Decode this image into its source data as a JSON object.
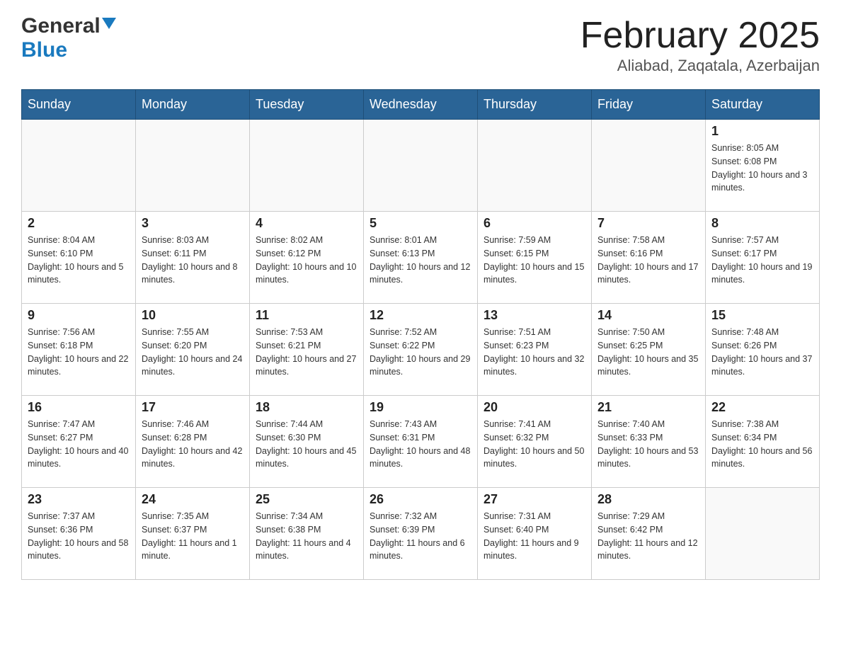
{
  "header": {
    "logo_general": "General",
    "logo_blue": "Blue",
    "month_title": "February 2025",
    "location": "Aliabad, Zaqatala, Azerbaijan"
  },
  "weekdays": [
    "Sunday",
    "Monday",
    "Tuesday",
    "Wednesday",
    "Thursday",
    "Friday",
    "Saturday"
  ],
  "weeks": [
    [
      {
        "day": "",
        "info": ""
      },
      {
        "day": "",
        "info": ""
      },
      {
        "day": "",
        "info": ""
      },
      {
        "day": "",
        "info": ""
      },
      {
        "day": "",
        "info": ""
      },
      {
        "day": "",
        "info": ""
      },
      {
        "day": "1",
        "info": "Sunrise: 8:05 AM\nSunset: 6:08 PM\nDaylight: 10 hours and 3 minutes."
      }
    ],
    [
      {
        "day": "2",
        "info": "Sunrise: 8:04 AM\nSunset: 6:10 PM\nDaylight: 10 hours and 5 minutes."
      },
      {
        "day": "3",
        "info": "Sunrise: 8:03 AM\nSunset: 6:11 PM\nDaylight: 10 hours and 8 minutes."
      },
      {
        "day": "4",
        "info": "Sunrise: 8:02 AM\nSunset: 6:12 PM\nDaylight: 10 hours and 10 minutes."
      },
      {
        "day": "5",
        "info": "Sunrise: 8:01 AM\nSunset: 6:13 PM\nDaylight: 10 hours and 12 minutes."
      },
      {
        "day": "6",
        "info": "Sunrise: 7:59 AM\nSunset: 6:15 PM\nDaylight: 10 hours and 15 minutes."
      },
      {
        "day": "7",
        "info": "Sunrise: 7:58 AM\nSunset: 6:16 PM\nDaylight: 10 hours and 17 minutes."
      },
      {
        "day": "8",
        "info": "Sunrise: 7:57 AM\nSunset: 6:17 PM\nDaylight: 10 hours and 19 minutes."
      }
    ],
    [
      {
        "day": "9",
        "info": "Sunrise: 7:56 AM\nSunset: 6:18 PM\nDaylight: 10 hours and 22 minutes."
      },
      {
        "day": "10",
        "info": "Sunrise: 7:55 AM\nSunset: 6:20 PM\nDaylight: 10 hours and 24 minutes."
      },
      {
        "day": "11",
        "info": "Sunrise: 7:53 AM\nSunset: 6:21 PM\nDaylight: 10 hours and 27 minutes."
      },
      {
        "day": "12",
        "info": "Sunrise: 7:52 AM\nSunset: 6:22 PM\nDaylight: 10 hours and 29 minutes."
      },
      {
        "day": "13",
        "info": "Sunrise: 7:51 AM\nSunset: 6:23 PM\nDaylight: 10 hours and 32 minutes."
      },
      {
        "day": "14",
        "info": "Sunrise: 7:50 AM\nSunset: 6:25 PM\nDaylight: 10 hours and 35 minutes."
      },
      {
        "day": "15",
        "info": "Sunrise: 7:48 AM\nSunset: 6:26 PM\nDaylight: 10 hours and 37 minutes."
      }
    ],
    [
      {
        "day": "16",
        "info": "Sunrise: 7:47 AM\nSunset: 6:27 PM\nDaylight: 10 hours and 40 minutes."
      },
      {
        "day": "17",
        "info": "Sunrise: 7:46 AM\nSunset: 6:28 PM\nDaylight: 10 hours and 42 minutes."
      },
      {
        "day": "18",
        "info": "Sunrise: 7:44 AM\nSunset: 6:30 PM\nDaylight: 10 hours and 45 minutes."
      },
      {
        "day": "19",
        "info": "Sunrise: 7:43 AM\nSunset: 6:31 PM\nDaylight: 10 hours and 48 minutes."
      },
      {
        "day": "20",
        "info": "Sunrise: 7:41 AM\nSunset: 6:32 PM\nDaylight: 10 hours and 50 minutes."
      },
      {
        "day": "21",
        "info": "Sunrise: 7:40 AM\nSunset: 6:33 PM\nDaylight: 10 hours and 53 minutes."
      },
      {
        "day": "22",
        "info": "Sunrise: 7:38 AM\nSunset: 6:34 PM\nDaylight: 10 hours and 56 minutes."
      }
    ],
    [
      {
        "day": "23",
        "info": "Sunrise: 7:37 AM\nSunset: 6:36 PM\nDaylight: 10 hours and 58 minutes."
      },
      {
        "day": "24",
        "info": "Sunrise: 7:35 AM\nSunset: 6:37 PM\nDaylight: 11 hours and 1 minute."
      },
      {
        "day": "25",
        "info": "Sunrise: 7:34 AM\nSunset: 6:38 PM\nDaylight: 11 hours and 4 minutes."
      },
      {
        "day": "26",
        "info": "Sunrise: 7:32 AM\nSunset: 6:39 PM\nDaylight: 11 hours and 6 minutes."
      },
      {
        "day": "27",
        "info": "Sunrise: 7:31 AM\nSunset: 6:40 PM\nDaylight: 11 hours and 9 minutes."
      },
      {
        "day": "28",
        "info": "Sunrise: 7:29 AM\nSunset: 6:42 PM\nDaylight: 11 hours and 12 minutes."
      },
      {
        "day": "",
        "info": ""
      }
    ]
  ]
}
